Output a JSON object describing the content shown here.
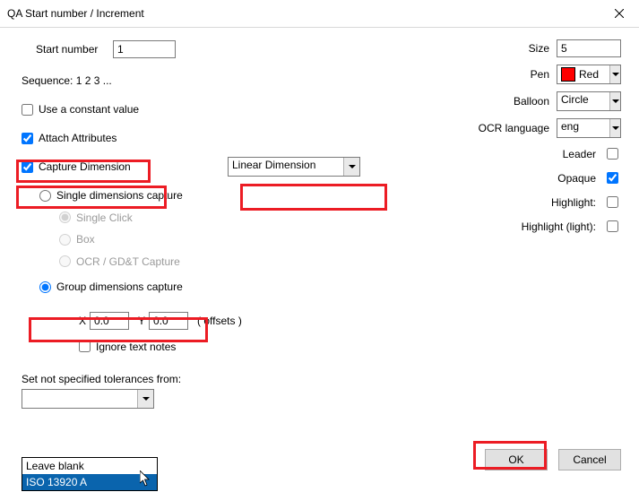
{
  "window": {
    "title": "QA Start number / Increment"
  },
  "left": {
    "start_number_label": "Start number",
    "start_number_value": "1",
    "sequence_label": "Sequence:  1 2 3 ...",
    "constant_label": "Use a constant value",
    "attach_label": "Attach Attributes",
    "capture_label": "Capture Dimension",
    "dimtype_value": "Linear Dimension",
    "single_caption": "Single dimensions capture",
    "single_click": "Single Click",
    "box": "Box",
    "ocr": "OCR / GD&T Capture",
    "group_caption": "Group dimensions capture",
    "x_label": "X",
    "x_value": "0.0",
    "y_label": "Y",
    "y_value": "0.0",
    "offsets_label": "( offsets )",
    "ignore_label": "Ignore text notes",
    "tol_label": "Set not specified tolerances from:",
    "tol_value": "",
    "tol_options": {
      "leaveblank": "Leave blank",
      "iso": "ISO 13920 A"
    }
  },
  "right": {
    "size_label": "Size",
    "size_value": "5",
    "pen_label": "Pen",
    "pen_value": "Red",
    "balloon_label": "Balloon",
    "balloon_value": "Circle",
    "ocrlang_label": "OCR language",
    "ocrlang_value": "eng",
    "leader_label": "Leader",
    "opaque_label": "Opaque",
    "highlight_label": "Highlight:",
    "highlight_light_label": "Highlight (light):"
  },
  "buttons": {
    "ok": "OK",
    "cancel": "Cancel"
  }
}
